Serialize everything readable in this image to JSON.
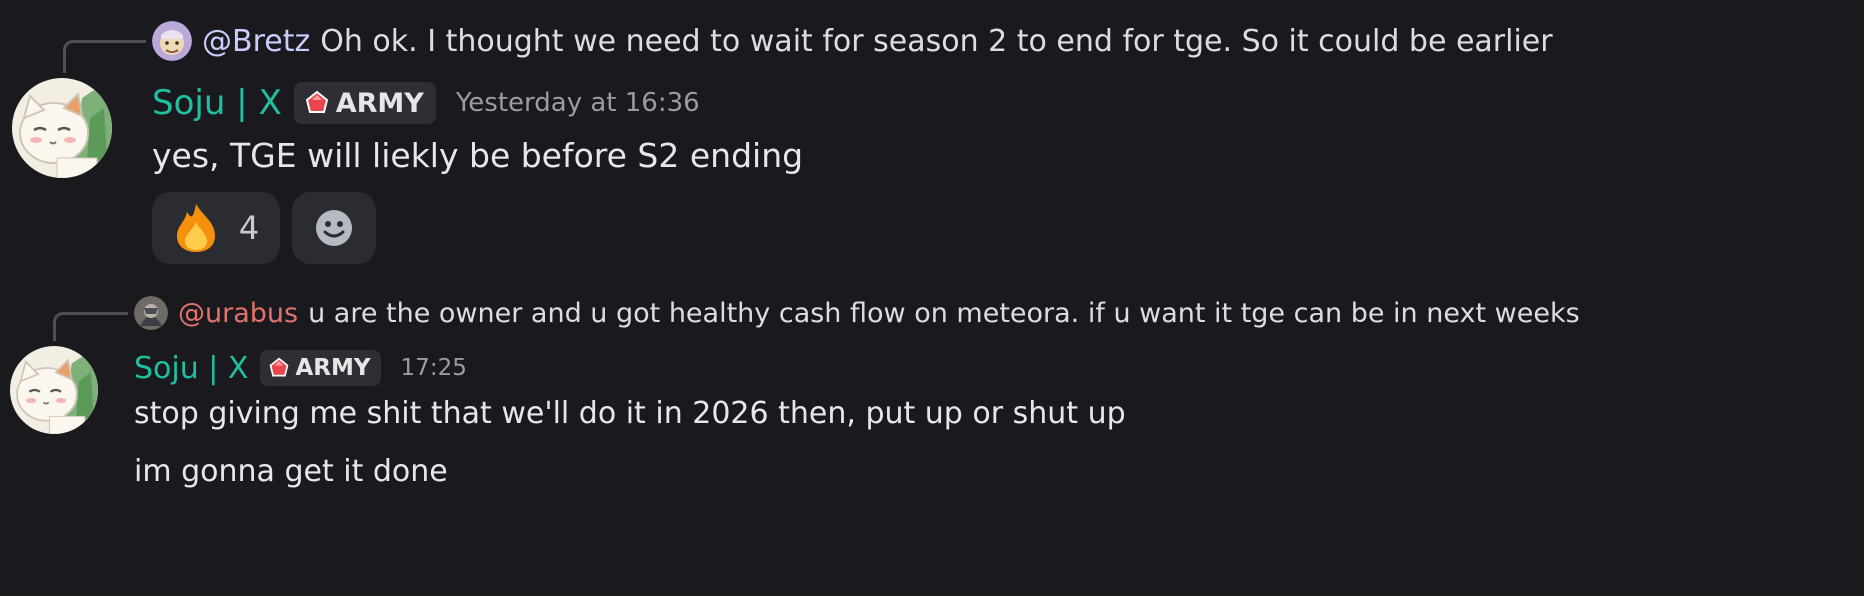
{
  "messages": [
    {
      "reply": {
        "mention": "@Bretz",
        "mention_color": "#c9cdfb",
        "text": "Oh ok. I thought we need to wait for season 2 to end for tge. So it could be earlier"
      },
      "author": "Soju | X",
      "badge": "ARMY",
      "timestamp": "Yesterday at 16:36",
      "lines": [
        "yes, TGE will liekly be before S2 ending"
      ],
      "reactions": [
        {
          "emoji": "fire-emoji",
          "count": "4"
        },
        {
          "emoji": "add-reaction-icon"
        }
      ]
    },
    {
      "reply": {
        "mention": "@urabus",
        "mention_color": "#e2736b",
        "text": "u are the owner and u got healthy cash flow on meteora. if u want it tge can be in next weeks"
      },
      "author": "Soju | X",
      "badge": "ARMY",
      "timestamp": "17:25",
      "lines": [
        "stop giving me shit that we'll do it in 2026 then, put up or shut up",
        "im gonna get it done"
      ]
    }
  ],
  "colors": {
    "background": "#1a1a1e",
    "username": "#1fbf9f",
    "badge_bg": "#2e2f35",
    "reaction_bg": "#2b2c32"
  }
}
